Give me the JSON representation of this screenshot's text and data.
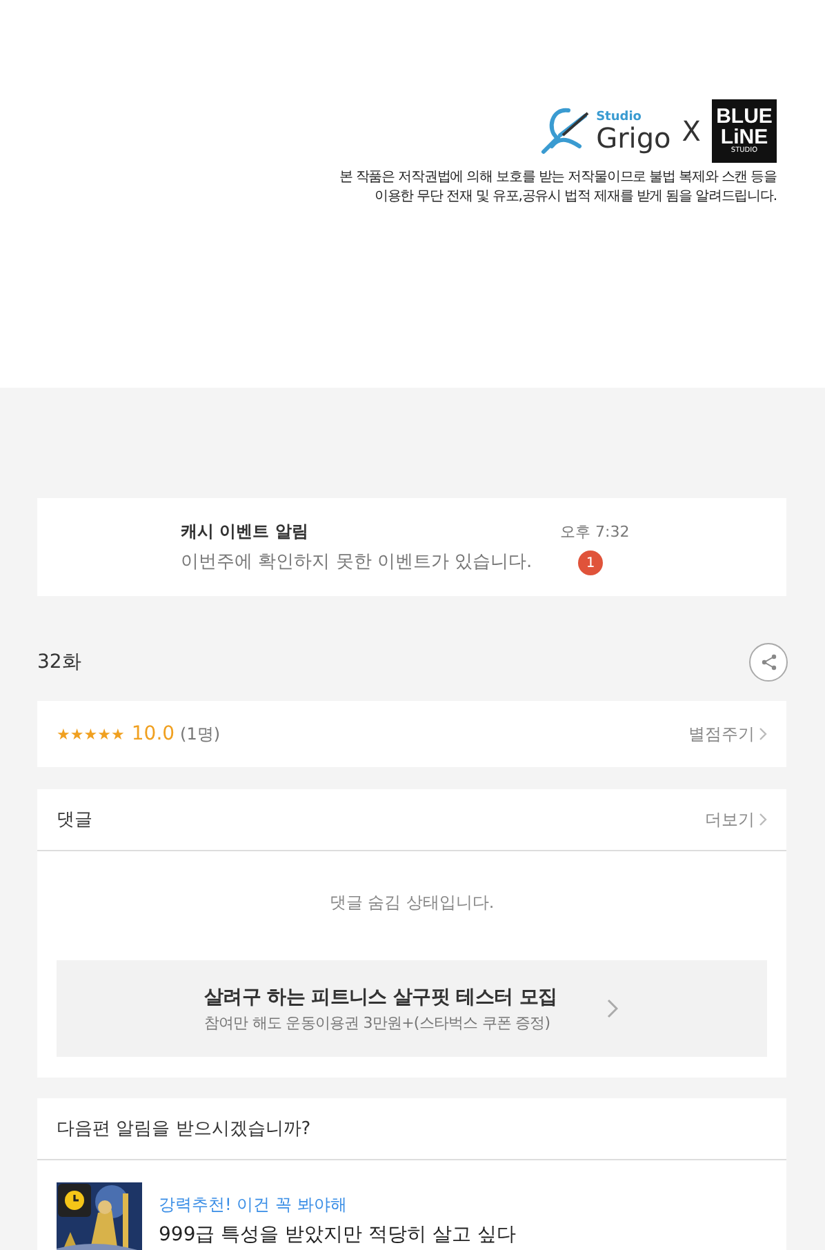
{
  "credits": {
    "studio_label": "Studio",
    "studio_name": "Grigo",
    "separator": "X",
    "partner_lines": [
      "BLUE",
      "LiNE"
    ],
    "partner_sub": "STUDIO",
    "notice": [
      "본 작품은 저작권법에 의해 보호를 받는 저작물이므로 불법 복제와 스캔 등을",
      "이용한 무단 전재 및 유포,공유시 법적 제재를 받게 됨을 알려드립니다."
    ]
  },
  "notification": {
    "title": "캐시 이벤트 알림",
    "message": "이번주에 확인하지 못한 이벤트가 있습니다.",
    "time": "오후 7:32",
    "badge": "1"
  },
  "episode": {
    "title": "32화"
  },
  "rating": {
    "stars": 5,
    "score": "10.0",
    "count": "(1명)",
    "action": "별점주기"
  },
  "comments": {
    "title": "댓글",
    "more": "더보기",
    "status": "댓글 숨김 상태입니다.",
    "ad": {
      "title": "살려구 하는 피트니스 살구핏 테스터 모집",
      "subtitle": "참여만 해도 운동이용권 3만원+(스타벅스 쿠폰 증정)"
    }
  },
  "next": {
    "question": "다음편 알림을 받으시겠습니까?",
    "recommend": {
      "kind": "picture",
      "tag": "강력추천! 이건 꼭 봐야해",
      "title": "999급 특성을 받았지만 적당히 살고 싶다"
    }
  }
}
